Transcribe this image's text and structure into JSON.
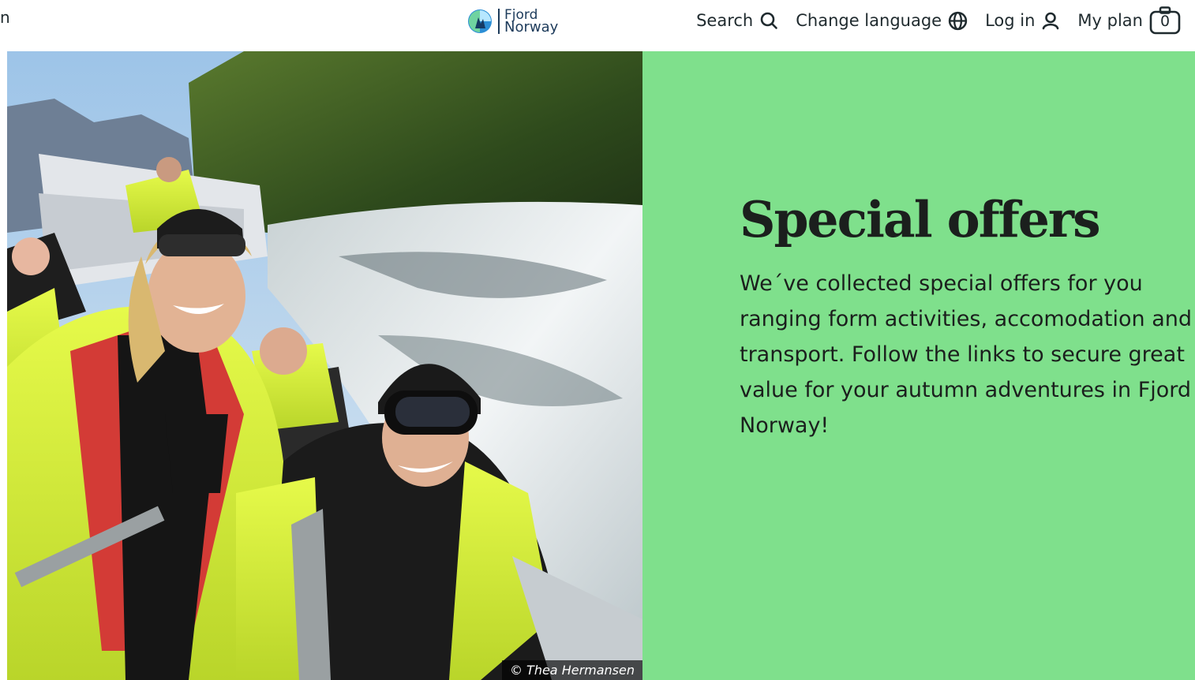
{
  "header": {
    "menu_stub": "n",
    "logo": {
      "line1": "Fjord",
      "line2": "Norway",
      "icon": "fjord-norway-logo-icon"
    },
    "nav": {
      "search": {
        "label": "Search",
        "icon": "search-icon"
      },
      "language": {
        "label": "Change language",
        "icon": "globe-icon"
      },
      "login": {
        "label": "Log in",
        "icon": "user-icon"
      },
      "plan": {
        "label": "My plan",
        "icon": "bag-icon",
        "count": "0"
      }
    }
  },
  "hero": {
    "credit": "© Thea Hermansen",
    "alt_colors": {
      "jacket": "#d6f03a",
      "water": "#e9eef0",
      "hill": "#3c5a22"
    }
  },
  "panel": {
    "background": "#7fe08c",
    "title": "Special offers",
    "body": "We´ve collected special offers for you ranging form activities, accomodation and transport. Follow the links to secure great value for your autumn adventures in Fjord Norway!"
  }
}
